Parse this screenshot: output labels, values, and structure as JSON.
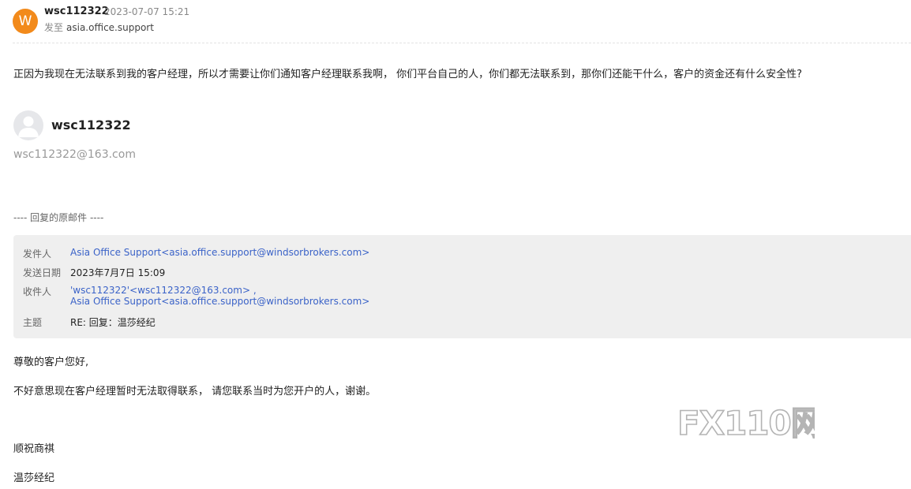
{
  "header": {
    "avatar_letter": "W",
    "avatar_color": "#f28a1b",
    "sender": "wsc112322",
    "time": "2023-07-07 15:21",
    "to_label": "发至",
    "to": "asia.office.support"
  },
  "message": {
    "body": "正因为我现在无法联系到我的客户经理，所以才需要让你们通知客户经理联系我啊， 你们平台自己的人，你们都无法联系到，那你们还能干什么，客户的资金还有什么安全性?"
  },
  "signature": {
    "name": "wsc112322",
    "email": "wsc112322@163.com"
  },
  "original": {
    "divider": "---- 回复的原邮件 ----",
    "from_label": "发件人",
    "from": "Asia Office Support<asia.office.support@windsorbrokers.com>",
    "date_label": "发送日期",
    "date": "2023年7月7日 15:09",
    "to_label": "收件人",
    "to_1": "'wsc112322'<wsc112322@163.com> ,",
    "to_2": "Asia Office Support<asia.office.support@windsorbrokers.com>",
    "subject_label": "主题",
    "subject": "RE: 回复：温莎经纪",
    "greeting": "尊敬的客户您好,",
    "content": "不好意思现在客户经理暂时无法取得联系， 请您联系当时为您开户的人，谢谢。",
    "closing": "顺祝商祺",
    "company": "温莎经纪"
  },
  "watermark": {
    "text": "FX110网"
  }
}
